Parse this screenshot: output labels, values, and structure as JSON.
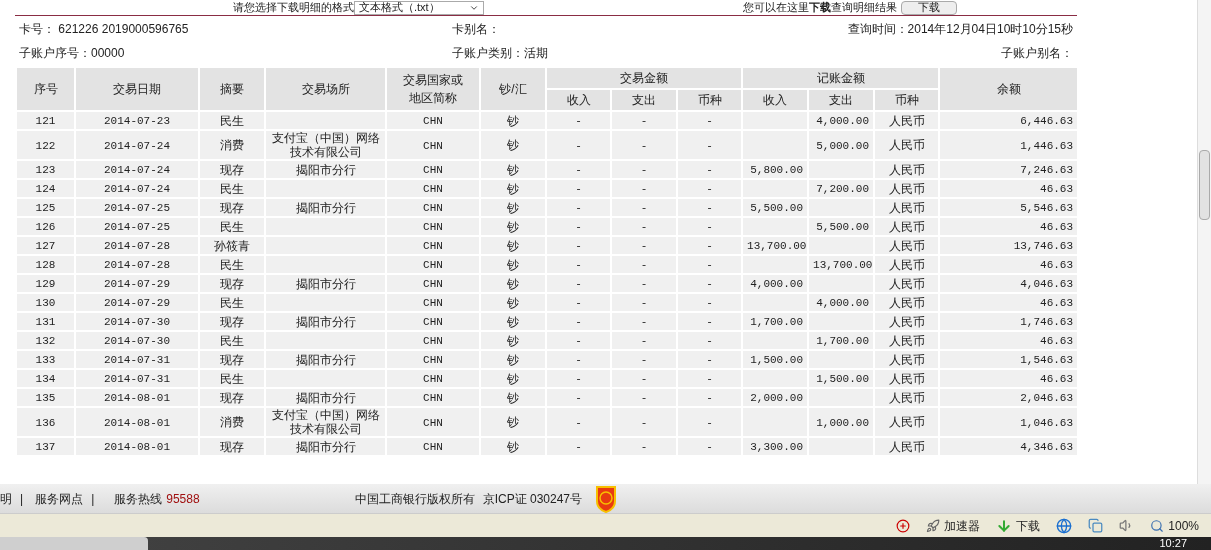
{
  "download_bar": {
    "format_label": "请您选择下载明细的格式",
    "format_value": "文本格式（.txt）",
    "hint": "您可以在这里**下载**查询明细结果",
    "button": "下载"
  },
  "info": {
    "card_no": "卡号：  621226 2019000596765",
    "card_alias": "卡别名：",
    "query_time": "查询时间：2014年12月04日10时10分15秒",
    "sub_no": "子账户序号：00000",
    "sub_type": "子账户类别：活期",
    "sub_alias": "子账户别名："
  },
  "table": {
    "columns": [
      "序号",
      "交易日期",
      "摘要",
      "交易场所",
      "交易国家或地区简称",
      "钞/汇"
    ],
    "group_tx": "交易金额",
    "group_post": "记账金额",
    "sub_columns": [
      "收入",
      "支出",
      "币种"
    ],
    "sub_columns_2": [
      "收入",
      "支出",
      "币种"
    ],
    "balance_column": "余额",
    "rows": [
      {
        "no": "121",
        "date": "2014-07-23",
        "summary": "民生",
        "country": "CHN",
        "cash": "钞",
        "tx_in": "-",
        "tx_out": "-",
        "tx_cur": "-",
        "post_out": "4,000.00",
        "post_cur": "人民币",
        "balance": "6,446.63"
      },
      {
        "no": "122",
        "date": "2014-07-24",
        "summary": "消费",
        "place": "支付宝（中国）网络技术有限公司",
        "country": "CHN",
        "cash": "钞",
        "tx_in": "-",
        "tx_out": "-",
        "tx_cur": "-",
        "post_out": "5,000.00",
        "post_cur": "人民币",
        "balance": "1,446.63"
      },
      {
        "no": "123",
        "date": "2014-07-24",
        "summary": "现存",
        "place": "揭阳市分行",
        "country": "CHN",
        "cash": "钞",
        "tx_in": "-",
        "tx_out": "-",
        "tx_cur": "-",
        "post_in": "5,800.00",
        "post_cur": "人民币",
        "balance": "7,246.63"
      },
      {
        "no": "124",
        "date": "2014-07-24",
        "summary": "民生",
        "country": "CHN",
        "cash": "钞",
        "tx_in": "-",
        "tx_out": "-",
        "tx_cur": "-",
        "post_out": "7,200.00",
        "post_cur": "人民币",
        "balance": "46.63"
      },
      {
        "no": "125",
        "date": "2014-07-25",
        "summary": "现存",
        "place": "揭阳市分行",
        "country": "CHN",
        "cash": "钞",
        "tx_in": "-",
        "tx_out": "-",
        "tx_cur": "-",
        "post_in": "5,500.00",
        "post_cur": "人民币",
        "balance": "5,546.63"
      },
      {
        "no": "126",
        "date": "2014-07-25",
        "summary": "民生",
        "country": "CHN",
        "cash": "钞",
        "tx_in": "-",
        "tx_out": "-",
        "tx_cur": "-",
        "post_out": "5,500.00",
        "post_cur": "人民币",
        "balance": "46.63"
      },
      {
        "no": "127",
        "date": "2014-07-28",
        "summary": "孙筱青",
        "country": "CHN",
        "cash": "钞",
        "tx_in": "-",
        "tx_out": "-",
        "tx_cur": "-",
        "post_in": "13,700.00",
        "post_cur": "人民币",
        "balance": "13,746.63"
      },
      {
        "no": "128",
        "date": "2014-07-28",
        "summary": "民生",
        "country": "CHN",
        "cash": "钞",
        "tx_in": "-",
        "tx_out": "-",
        "tx_cur": "-",
        "post_out": "13,700.00",
        "post_cur": "人民币",
        "balance": "46.63"
      },
      {
        "no": "129",
        "date": "2014-07-29",
        "summary": "现存",
        "place": "揭阳市分行",
        "country": "CHN",
        "cash": "钞",
        "tx_in": "-",
        "tx_out": "-",
        "tx_cur": "-",
        "post_in": "4,000.00",
        "post_cur": "人民币",
        "balance": "4,046.63"
      },
      {
        "no": "130",
        "date": "2014-07-29",
        "summary": "民生",
        "country": "CHN",
        "cash": "钞",
        "tx_in": "-",
        "tx_out": "-",
        "tx_cur": "-",
        "post_out": "4,000.00",
        "post_cur": "人民币",
        "balance": "46.63"
      },
      {
        "no": "131",
        "date": "2014-07-30",
        "summary": "现存",
        "place": "揭阳市分行",
        "country": "CHN",
        "cash": "钞",
        "tx_in": "-",
        "tx_out": "-",
        "tx_cur": "-",
        "post_in": "1,700.00",
        "post_cur": "人民币",
        "balance": "1,746.63"
      },
      {
        "no": "132",
        "date": "2014-07-30",
        "summary": "民生",
        "country": "CHN",
        "cash": "钞",
        "tx_in": "-",
        "tx_out": "-",
        "tx_cur": "-",
        "post_out": "1,700.00",
        "post_cur": "人民币",
        "balance": "46.63"
      },
      {
        "no": "133",
        "date": "2014-07-31",
        "summary": "现存",
        "place": "揭阳市分行",
        "country": "CHN",
        "cash": "钞",
        "tx_in": "-",
        "tx_out": "-",
        "tx_cur": "-",
        "post_in": "1,500.00",
        "post_cur": "人民币",
        "balance": "1,546.63"
      },
      {
        "no": "134",
        "date": "2014-07-31",
        "summary": "民生",
        "country": "CHN",
        "cash": "钞",
        "tx_in": "-",
        "tx_out": "-",
        "tx_cur": "-",
        "post_out": "1,500.00",
        "post_cur": "人民币",
        "balance": "46.63"
      },
      {
        "no": "135",
        "date": "2014-08-01",
        "summary": "现存",
        "place": "揭阳市分行",
        "country": "CHN",
        "cash": "钞",
        "tx_in": "-",
        "tx_out": "-",
        "tx_cur": "-",
        "post_in": "2,000.00",
        "post_cur": "人民币",
        "balance": "2,046.63"
      },
      {
        "no": "136",
        "date": "2014-08-01",
        "summary": "消费",
        "place": "支付宝（中国）网络技术有限公司",
        "country": "CHN",
        "cash": "钞",
        "tx_in": "-",
        "tx_out": "-",
        "tx_cur": "-",
        "post_out": "1,000.00",
        "post_cur": "人民币",
        "balance": "1,046.63"
      },
      {
        "no": "137",
        "date": "2014-08-01",
        "summary": "现存",
        "place": "揭阳市分行",
        "country": "CHN",
        "cash": "钞",
        "tx_in": "-",
        "tx_out": "-",
        "tx_cur": "-",
        "post_in": "3,300.00",
        "post_cur": "人民币",
        "balance": "4,346.63"
      }
    ]
  },
  "footer": {
    "links": [
      "明",
      "服务网点"
    ],
    "separators": [
      "|",
      "|"
    ],
    "hotline_label": "服务热线",
    "hotline": "95588",
    "copyright": "中国工商银行版权所有",
    "icp": "京ICP证 030247号"
  },
  "status_bar": {
    "accelerator": "加速器",
    "download": "下载",
    "zoom": "100%"
  },
  "taskbar": {
    "clock": "10:27"
  }
}
